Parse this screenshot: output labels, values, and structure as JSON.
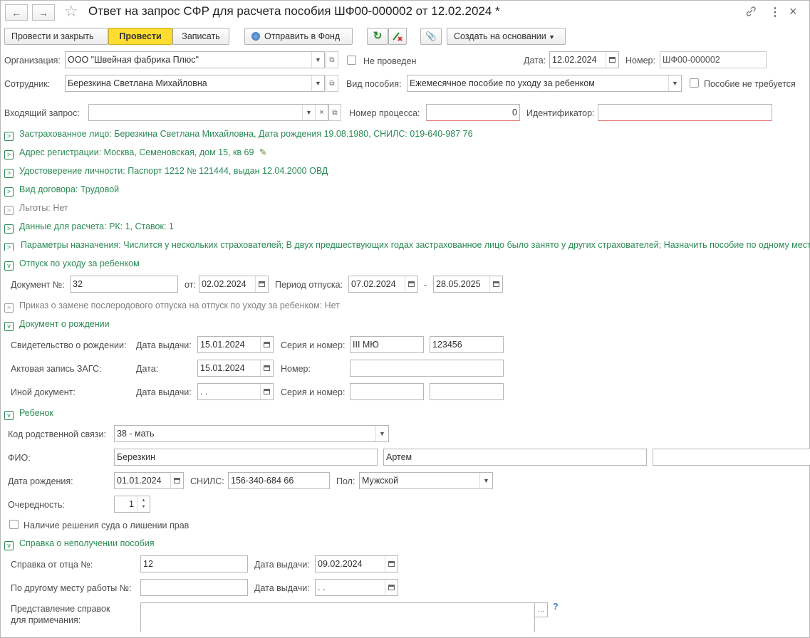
{
  "window": {
    "title": "Ответ на запрос СФР для расчета пособия ШФ00-000002 от 12.02.2024 *"
  },
  "icons": {
    "back": "←",
    "forward": "→",
    "star": "☆",
    "link": "🔗",
    "more": "⋮",
    "close": "×",
    "refresh": "↻",
    "clip": "📎",
    "chevron_down": "▾",
    "open": "⧉",
    "clear": "×",
    "question": "?",
    "pencil": "✎"
  },
  "toolbar": {
    "post_close": "Провести и закрыть",
    "post": "Провести",
    "save": "Записать",
    "send": "Отправить в Фонд",
    "create_based": "Создать на основании"
  },
  "header": {
    "org_label": "Организация:",
    "org_value": "ООО \"Швейная фабрика Плюс\"",
    "not_posted": "Не проведен",
    "date_label": "Дата:",
    "date_value": "12.02.2024",
    "number_label": "Номер:",
    "number_value": "ШФ00-000002",
    "employee_label": "Сотрудник:",
    "employee_value": "Березкина Светлана Михайловна",
    "benefit_type_label": "Вид пособия:",
    "benefit_type_value": "Ежемесячное пособие по уходу за ребенком",
    "no_benefit_label": "Пособие не требуется",
    "incoming_label": "Входящий запрос:",
    "incoming_value": "",
    "process_label": "Номер процесса:",
    "process_value": "0",
    "id_label": "Идентификатор:",
    "id_value": ""
  },
  "groups": {
    "insured": "Застрахованное лицо: Березкина Светлана Михайловна, Дата рождения 19.08.1980, СНИЛС: 019-640-987 76",
    "address": "Адрес регистрации: Москва,  Семеновская, дом 15, кв 69",
    "identity": "Удостоверение личности: Паспорт 1212 № 121444, выдан 12.04.2000 ОВД",
    "contract": "Вид договора: Трудовой",
    "benefits": "Льготы: Нет",
    "calc": "Данные для расчета: РК: 1, Ставок: 1",
    "params": "Параметры назначения: Числится у нескольких страхователей; В двух предшествующих годах застрахованное лицо было занято у других страхователей; Назначить пособие по одному месту работы",
    "leave": "Отпуск по уходу за ребенком",
    "order": "Приказ о замене послеродового отпуска на отпуск по уходу за ребенком: Нет",
    "birth_doc": "Документ о рождении",
    "child": "Ребенок",
    "certificate": "Справка о неполучении пособия"
  },
  "leave": {
    "doc_label": "Документ №:",
    "doc_value": "32",
    "from_label": "от:",
    "from_value": "02.02.2024",
    "period_label": "Период отпуска:",
    "period_start": "07.02.2024",
    "dash": "-",
    "period_end": "28.05.2025"
  },
  "birth": {
    "cert_label": "Свидетельство о рождении:",
    "issue_label": "Дата выдачи:",
    "cert_date": "15.01.2024",
    "series_label": "Серия и номер:",
    "cert_series": "III МЮ",
    "cert_number": "123456",
    "act_label": "Актовая запись ЗАГС:",
    "act_date_label": "Дата:",
    "act_date": "15.01.2024",
    "act_number_label": "Номер:",
    "act_number": "",
    "other_label": "Иной документ:",
    "other_issue_label": "Дата выдачи:",
    "other_date": " .  .",
    "other_series_label": "Серия и номер:",
    "other_series": "",
    "other_number": ""
  },
  "child": {
    "relation_label": "Код родственной связи:",
    "relation_value": "38 - мать",
    "fio_label": "ФИО:",
    "last_name": "Березкин",
    "first_name": "Артем",
    "middle_name": "",
    "birth_label": "Дата рождения:",
    "birth_value": "01.01.2024",
    "snils_label": "СНИЛС:",
    "snils_value": "156-340-684 66",
    "sex_label": "Пол:",
    "sex_value": "Мужской",
    "order_label": "Очередность:",
    "order_value": "1",
    "court_label": "Наличие решения суда о лишении прав"
  },
  "certificate": {
    "father_label": "Справка от отца №:",
    "father_value": "12",
    "father_date_label": "Дата выдачи:",
    "father_date": "09.02.2024",
    "other_label": "По другому месту работы №:",
    "other_value": "",
    "other_date_label": "Дата выдачи:",
    "other_date": " .  .",
    "note_label_1": "Представление справок",
    "note_label_2": "для примечания:",
    "note_value": ""
  }
}
